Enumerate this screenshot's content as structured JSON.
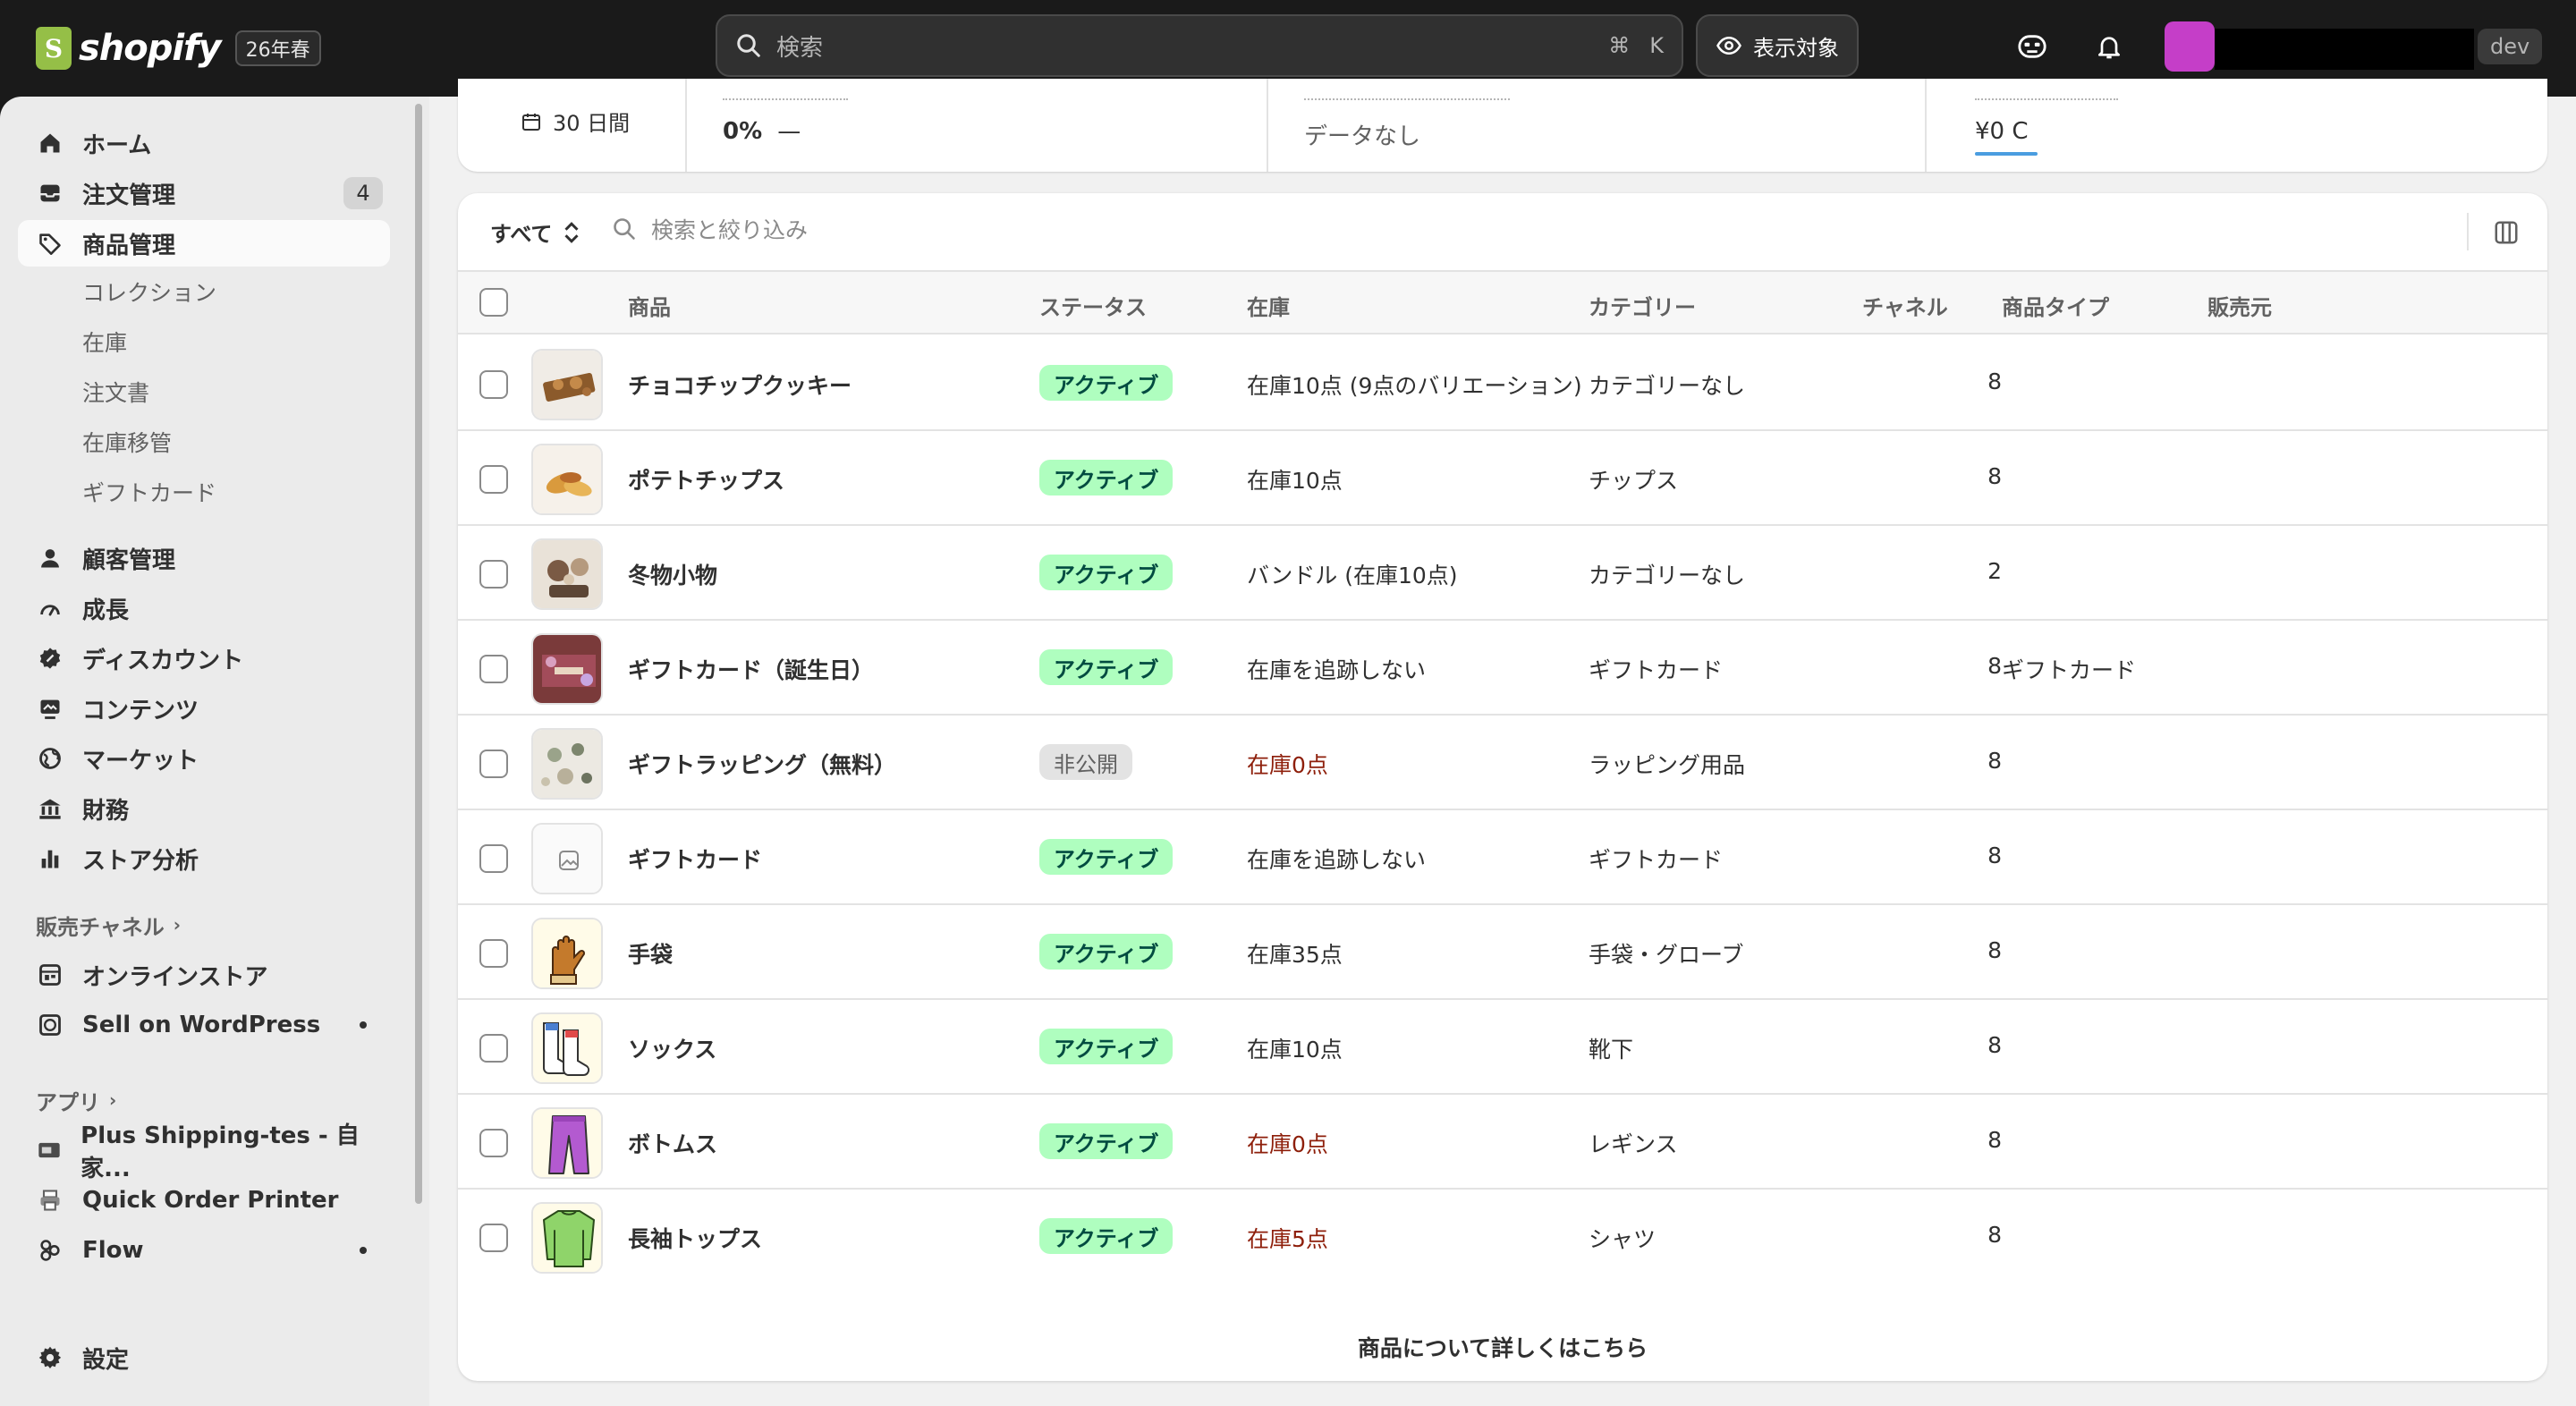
{
  "topbar": {
    "logo_text": "shopify",
    "logo_badge": "26年春",
    "search_placeholder": "検索",
    "shortcut_cmd": "⌘",
    "shortcut_key": "K",
    "view_button": "表示対象",
    "dev_badge": "dev",
    "avatar_color": "#c53ec8"
  },
  "sidebar": {
    "main_items": [
      {
        "label": "ホーム",
        "icon": "home-icon"
      },
      {
        "label": "注文管理",
        "icon": "inbox-icon",
        "count": "4"
      },
      {
        "label": "商品管理",
        "icon": "tag-icon",
        "active": true
      }
    ],
    "product_subitems": [
      "コレクション",
      "在庫",
      "注文書",
      "在庫移管",
      "ギフトカード"
    ],
    "secondary_items": [
      {
        "label": "顧客管理",
        "icon": "person-icon"
      },
      {
        "label": "成長",
        "icon": "gauge-icon"
      },
      {
        "label": "ディスカウント",
        "icon": "discount-icon"
      },
      {
        "label": "コンテンツ",
        "icon": "content-icon"
      },
      {
        "label": "マーケット",
        "icon": "globe-icon"
      },
      {
        "label": "財務",
        "icon": "bank-icon"
      },
      {
        "label": "ストア分析",
        "icon": "bar-chart-icon"
      }
    ],
    "sales_channels_label": "販売チャネル",
    "sales_channels": [
      {
        "label": "オンラインストア",
        "icon": "store-icon"
      },
      {
        "label": "Sell on WordPress",
        "icon": "wordpress-icon",
        "dot": true
      }
    ],
    "apps_label": "アプリ",
    "apps": [
      {
        "label": "Plus Shipping-tes - 自家...",
        "icon": "shipping-app-icon"
      },
      {
        "label": "Quick Order Printer",
        "icon": "printer-icon"
      },
      {
        "label": "Flow",
        "icon": "flow-icon",
        "dot": true
      }
    ],
    "settings_label": "設定"
  },
  "metrics": {
    "date_range": "30 日間",
    "value_1": "0%",
    "value_1_suffix": "—",
    "value_2": "データなし",
    "value_3": "¥0 C"
  },
  "filters": {
    "tab_label": "すべて",
    "search_placeholder": "検索と絞り込み"
  },
  "table": {
    "headers": [
      "商品",
      "ステータス",
      "在庫",
      "カテゴリー",
      "チャネル",
      "商品タイプ",
      "販売元"
    ],
    "rows": [
      {
        "name": "チョコチップクッキー",
        "status": "アクティブ",
        "status_type": "active",
        "inventory": "在庫10点 (9点のバリエーション)",
        "inventory_red": false,
        "category": "カテゴリーなし",
        "channels": "8",
        "product_type": "",
        "thumb": "cookie"
      },
      {
        "name": "ポテトチップス",
        "status": "アクティブ",
        "status_type": "active",
        "inventory": "在庫10点",
        "inventory_red": false,
        "category": "チップス",
        "channels": "8",
        "product_type": "",
        "thumb": "chips"
      },
      {
        "name": "冬物小物",
        "status": "アクティブ",
        "status_type": "active",
        "inventory": "バンドル (在庫10点)",
        "inventory_red": false,
        "category": "カテゴリーなし",
        "channels": "2",
        "product_type": "",
        "thumb": "winter"
      },
      {
        "name": "ギフトカード（誕生日）",
        "status": "アクティブ",
        "status_type": "active",
        "inventory": "在庫を追跡しない",
        "inventory_red": false,
        "category": "ギフトカード",
        "channels": "8",
        "product_type": "ギフトカード",
        "thumb": "birthday"
      },
      {
        "name": "ギフトラッピング（無料）",
        "status": "非公開",
        "status_type": "draft",
        "inventory": "在庫0点",
        "inventory_red": true,
        "category": "ラッピング用品",
        "channels": "8",
        "product_type": "",
        "thumb": "wrapping"
      },
      {
        "name": "ギフトカード",
        "status": "アクティブ",
        "status_type": "active",
        "inventory": "在庫を追跡しない",
        "inventory_red": false,
        "category": "ギフトカード",
        "channels": "8",
        "product_type": "",
        "thumb": "placeholder"
      },
      {
        "name": "手袋",
        "status": "アクティブ",
        "status_type": "active",
        "inventory": "在庫35点",
        "inventory_red": false,
        "category": "手袋・グローブ",
        "channels": "8",
        "product_type": "",
        "thumb": "gloves"
      },
      {
        "name": "ソックス",
        "status": "アクティブ",
        "status_type": "active",
        "inventory": "在庫10点",
        "inventory_red": false,
        "category": "靴下",
        "channels": "8",
        "product_type": "",
        "thumb": "socks"
      },
      {
        "name": "ボトムス",
        "status": "アクティブ",
        "status_type": "active",
        "inventory": "在庫0点",
        "inventory_red": true,
        "category": "レギンス",
        "channels": "8",
        "product_type": "",
        "thumb": "pants"
      },
      {
        "name": "長袖トップス",
        "status": "アクティブ",
        "status_type": "active",
        "inventory": "在庫5点",
        "inventory_red": true,
        "category": "シャツ",
        "channels": "8",
        "product_type": "",
        "thumb": "sweater"
      }
    ]
  },
  "footer": {
    "learn_more": "商品について詳しくはこちら"
  },
  "colors": {
    "active_badge_bg": "#affebf",
    "active_badge_fg": "#014b40",
    "critical_text": "#8e1f0b"
  }
}
